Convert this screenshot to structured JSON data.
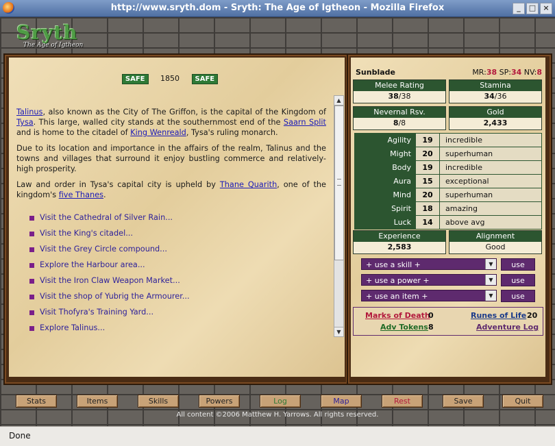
{
  "window": {
    "title": "http://www.sryth.dom - Sryth: The Age of Igtheon - Mozilla Firefox",
    "min": "_",
    "max": "□",
    "close": "×"
  },
  "logo": {
    "main": "Sryth",
    "sub": "The Age of Igtheon"
  },
  "location": {
    "safe_left": "SAFE",
    "number": "1850",
    "safe_right": "SAFE"
  },
  "description": {
    "p1": {
      "l_talinus": "Talinus",
      "t1": ", also known as the City of The Griffon, is the capital of the Kingdom of ",
      "l_tysa": "Tysa",
      "t2": ". This large, walled city stands at the southernmost end of the ",
      "l_saarn": "Saarn Split",
      "t3": " and is home to the citadel of ",
      "l_king": "King Wenreald",
      "t4": ", Tysa's ruling monarch."
    },
    "p2": "Due to its location and importance in the affairs of the realm, Talinus and the towns and villages that surround it enjoy bustling commerce and relatively-high prosperity.",
    "p3": {
      "t1": "Law and order in Tysa's capital city is upheld by ",
      "l_thane": "Thane Quarith",
      "t2": ", one of the kingdom's ",
      "l_thanes": "five Thanes",
      "t3": "."
    }
  },
  "actions": [
    "Visit the Cathedral of Silver Rain...",
    "Visit the King's citadel...",
    "Visit the Grey Circle compound...",
    "Explore the Harbour area...",
    "Visit the Iron Claw Weapon Market...",
    "Visit the shop of Yubrig the Armourer...",
    "Visit Thofyra's Training Yard...",
    "Explore Talinus..."
  ],
  "scroll": {
    "up": "▲",
    "down": "▼"
  },
  "character": {
    "name": "Sunblade",
    "mr_label": "MR:",
    "mr": "38",
    "sp_label": "SP:",
    "sp": "34",
    "nv_label": "NV:",
    "nv": "8",
    "melee": {
      "label": "Melee Rating",
      "cur": "38",
      "max": "/38"
    },
    "stamina": {
      "label": "Stamina",
      "cur": "34",
      "max": "/36"
    },
    "nevernal": {
      "label": "Nevernal Rsv.",
      "cur": "8",
      "max": "/8"
    },
    "gold": {
      "label": "Gold",
      "value": "2,433"
    },
    "attributes": [
      {
        "name": "Agility",
        "value": "19",
        "desc": "incredible"
      },
      {
        "name": "Might",
        "value": "20",
        "desc": "superhuman"
      },
      {
        "name": "Body",
        "value": "19",
        "desc": "incredible"
      },
      {
        "name": "Aura",
        "value": "15",
        "desc": "exceptional"
      },
      {
        "name": "Mind",
        "value": "20",
        "desc": "superhuman"
      },
      {
        "name": "Spirit",
        "value": "18",
        "desc": "amazing"
      },
      {
        "name": "Luck",
        "value": "14",
        "desc": "above avg"
      }
    ],
    "experience": {
      "label": "Experience",
      "value": "2,583"
    },
    "alignment": {
      "label": "Alignment",
      "value": "Good"
    }
  },
  "abilities": [
    {
      "label": "+ use a skill +",
      "button": "use"
    },
    {
      "label": "+ use a power +",
      "button": "use"
    },
    {
      "label": "+ use an item +",
      "button": "use"
    }
  ],
  "tokens": {
    "marks_label": "Marks of Death",
    "marks": "0",
    "runes_label": "Runes of Life",
    "runes": "20",
    "adv_label": "Adv Tokens",
    "adv": "8",
    "log_label": "Adventure Log"
  },
  "nav": [
    "Stats",
    "Items",
    "Skills",
    "Powers",
    "Log",
    "Map",
    "Rest",
    "Save",
    "Quit"
  ],
  "copyright": "All content ©2006 Matthew H. Yarrows. All rights reserved.",
  "status": "Done",
  "colors": {
    "accent_green": "#2c5530",
    "accent_purple": "#5e2a6e",
    "stat_red": "#b2183c",
    "link_blue": "#1a1ab8"
  }
}
